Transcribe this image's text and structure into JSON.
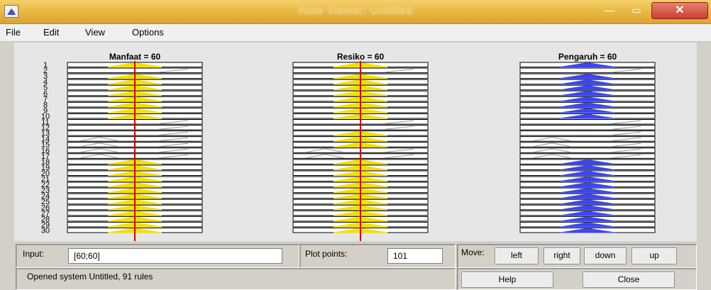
{
  "window": {
    "title": "Rule Viewer: Untitled"
  },
  "menu": [
    {
      "label": "File"
    },
    {
      "label": "Edit"
    },
    {
      "label": "View"
    },
    {
      "label": "Options"
    }
  ],
  "plot": {
    "columns": [
      {
        "title": "Manfaat = 60",
        "color": "#f3e000"
      },
      {
        "title": "Resiko = 60",
        "color": "#f3e000"
      },
      {
        "title": "Pengaruh = 60",
        "color": "#3c46f0"
      }
    ],
    "rule_numbers": [
      "1",
      "2",
      "3",
      "4",
      "5",
      "6",
      "7",
      "8",
      "9",
      "10",
      "11",
      "12",
      "13",
      "14",
      "15",
      "16",
      "17",
      "18",
      "19",
      "20",
      "21",
      "22",
      "23",
      "24",
      "25",
      "26",
      "27",
      "28",
      "29",
      "30"
    ]
  },
  "controls": {
    "input_label": "Input:",
    "input_value": "[60;60]",
    "plot_points_label": "Plot points:",
    "plot_points_value": "101",
    "move_label": "Move:",
    "left": "left",
    "right": "right",
    "down": "down",
    "up": "up",
    "status": "Opened system Untitled, 91 rules",
    "help": "Help",
    "close": "Close"
  },
  "colors": {
    "titlebar": "#e8b63e",
    "fill_yellow": "#f3e000",
    "fill_blue": "#3c46f0",
    "indicator": "#d40000"
  }
}
